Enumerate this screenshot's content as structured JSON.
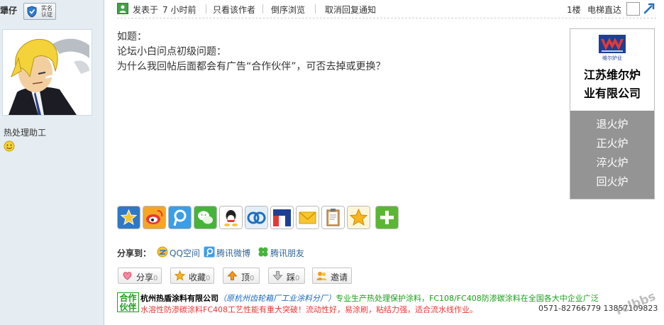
{
  "user": {
    "name": "犟仔",
    "verify_badge": "实名认证",
    "group": "热处理助工"
  },
  "post_header": {
    "posted": "发表于",
    "time": "7 小时前",
    "only_author": "只看该作者",
    "reverse_view": "倒序浏览",
    "cancel_notify": "取消回复通知",
    "floor": "1楼",
    "elevator": "电梯直达"
  },
  "post": {
    "lines": [
      "如题：",
      "论坛小白问点初级问题：",
      "为什么我回帖后面都会有广告“合作伙伴”，可否去掉或更换？"
    ]
  },
  "side_ad": {
    "logo_text": "维尔炉业",
    "company_line1": "江苏维尔炉",
    "company_line2": "业有限公司",
    "services": [
      "退火炉",
      "正火炉",
      "淬火炉",
      "回火炉"
    ]
  },
  "share_icons": [
    "favorite-star-icon",
    "sina-weibo-icon",
    "tencent-weibo-icon",
    "wechat-icon",
    "qq-icon",
    "kaixin-icon",
    "renren-icon",
    "email-icon",
    "clipboard-icon",
    "bookmark-star-icon",
    "more-plus-icon"
  ],
  "share_to": {
    "label": "分享到：",
    "links": [
      {
        "text": "QQ空间",
        "icon": "qzone-icon"
      },
      {
        "text": "腾讯微博",
        "icon": "tencent-weibo-icon"
      },
      {
        "text": "腾讯朋友",
        "icon": "clover-icon"
      }
    ]
  },
  "actions": {
    "share": {
      "label": "分享",
      "count": "0"
    },
    "favorite": {
      "label": "收藏",
      "count": "0"
    },
    "top": {
      "label": "顶",
      "count": "0"
    },
    "down": {
      "label": "踩",
      "count": "0"
    },
    "invite": {
      "label": "邀请"
    }
  },
  "partner_ad": {
    "badge_line1": "合作",
    "badge_line2": "伙伴",
    "company": "杭州热盾涂料有限公司",
    "branch": "（原杭州齿轮箱厂工业涂料分厂）",
    "desc": "专业生产热处理保护涂料，FC108/FC408防渗碳涂料在全国各大中企业广泛",
    "line2": "水溶性防渗碳涂料FC408工艺性能有重大突破！流动性好，易涂刷，粘结力强，适合流水线作业。",
    "phone": "0571-82766779  13857109823"
  },
  "watermark": "rclbbs",
  "colors": {
    "sidebar_bg": "#e5edf2",
    "ad_gray": "#949494",
    "link_blue": "#336699",
    "partner_green": "#1a9e1a",
    "partner_red": "#e53935"
  }
}
